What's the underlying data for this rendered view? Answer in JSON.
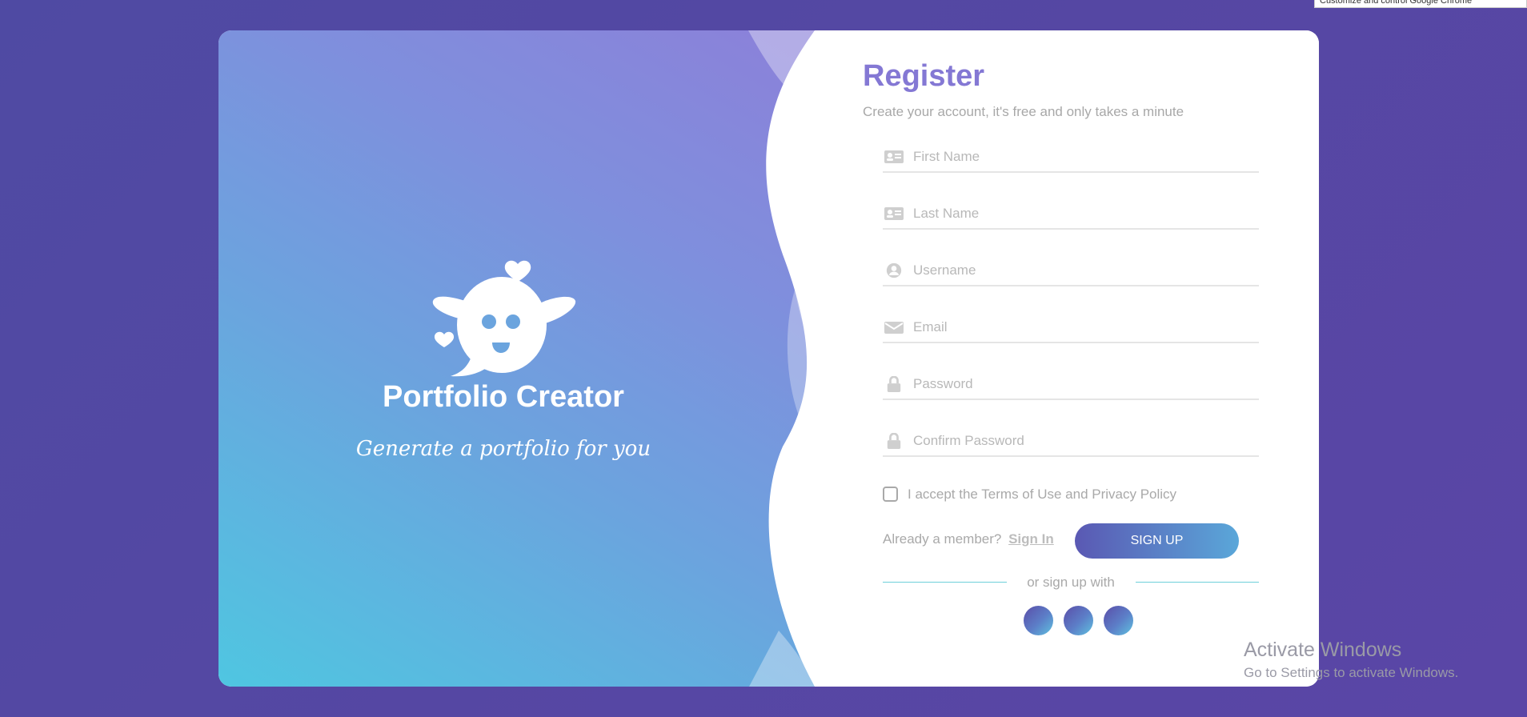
{
  "tooltip": {
    "text": "Customize and control Google Chrome"
  },
  "brand": {
    "title": "Portfolio Creator",
    "tagline": "Generate a portfolio for you"
  },
  "form": {
    "title": "Register",
    "subtitle": "Create your account, it's free and only takes a minute",
    "fields": [
      {
        "placeholder": "First Name",
        "icon": "id-card-icon"
      },
      {
        "placeholder": "Last Name",
        "icon": "id-card-icon"
      },
      {
        "placeholder": "Username",
        "icon": "user-circle-icon"
      },
      {
        "placeholder": "Email",
        "icon": "envelope-icon"
      },
      {
        "placeholder": "Password",
        "icon": "lock-icon"
      },
      {
        "placeholder": "Confirm Password",
        "icon": "lock-icon"
      }
    ],
    "terms_label": "I accept the Terms of Use and Privacy Policy",
    "member_text": "Already a member?",
    "signin_label": "Sign In",
    "signup_label": "SIGN UP",
    "divider_text": "or sign up with"
  },
  "watermark": {
    "line1": "Activate Windows",
    "line2": "Go to Settings to activate Windows."
  },
  "colors": {
    "accent": "#8478d4",
    "background": "#5547a3",
    "button_start": "#5a58b3",
    "button_end": "#5aa7d9",
    "divider": "#6ed0d9"
  }
}
